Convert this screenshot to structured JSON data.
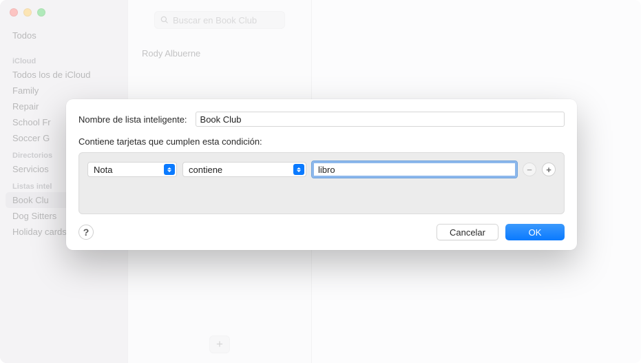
{
  "sidebar": {
    "all": "Todos",
    "section_icloud": "iCloud",
    "icloud_items": [
      "Todos los de iCloud",
      "Family",
      "Repair",
      "School Fr",
      "Soccer G"
    ],
    "section_dir": "Directorios",
    "dir_items": [
      "Servicios"
    ],
    "section_smart": "Listas intel",
    "smart_items": [
      "Book Clu",
      "Dog Sitters",
      "Holiday cards"
    ]
  },
  "middle": {
    "search_placeholder": "Buscar en Book Club",
    "contact": "Rody Albuerne",
    "add": "+"
  },
  "dialog": {
    "name_label": "Nombre de lista inteligente:",
    "name_value": "Book Club",
    "cond_label": "Contiene tarjetas que cumplen esta condición:",
    "field": "Nota",
    "op": "contiene",
    "value": "libro",
    "remove": "−",
    "add": "+",
    "help": "?",
    "cancel": "Cancelar",
    "ok": "OK"
  }
}
